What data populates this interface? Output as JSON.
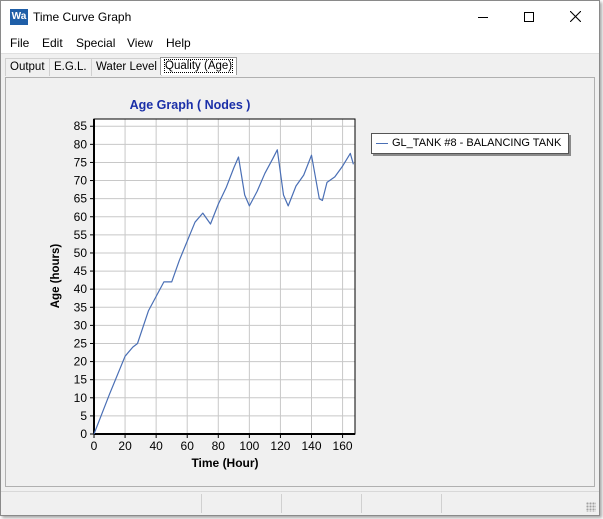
{
  "window": {
    "title": "Time Curve Graph",
    "app_icon_text": "Wa",
    "minimize_icon": "minimize-icon",
    "maximize_icon": "maximize-icon",
    "close_icon": "close-icon"
  },
  "menu": {
    "items": [
      "File",
      "Edit",
      "Special",
      "View",
      "Help"
    ]
  },
  "tabs": [
    {
      "label": "Output",
      "active": false
    },
    {
      "label": "E.G.L.",
      "active": false
    },
    {
      "label": "Water Level",
      "active": false
    },
    {
      "label": "Quality (Age)",
      "active": true
    }
  ],
  "colors": {
    "title": "#1a2fa8",
    "series": "#4a6fb5",
    "grid": "#c8c8c8"
  },
  "chart_data": {
    "type": "line",
    "title": "Age Graph ( Nodes )",
    "xlabel": "Time (Hour)",
    "ylabel": "Age (hours)",
    "xlim": [
      0,
      168
    ],
    "ylim": [
      0,
      87
    ],
    "xticks": [
      0,
      20,
      40,
      60,
      80,
      100,
      120,
      140,
      160
    ],
    "yticks": [
      0,
      5,
      10,
      15,
      20,
      25,
      30,
      35,
      40,
      45,
      50,
      55,
      60,
      65,
      70,
      75,
      80,
      85
    ],
    "grid": true,
    "legend_position": "right",
    "series": [
      {
        "name": "GL_TANK #8 - BALANCING TANK",
        "x": [
          0,
          10,
          20,
          25,
          28,
          35,
          45,
          50,
          55,
          65,
          70,
          75,
          80,
          85,
          90,
          93,
          97,
          100,
          105,
          110,
          115,
          118,
          122,
          125,
          130,
          135,
          140,
          145,
          147,
          150,
          155,
          160,
          165,
          167
        ],
        "y": [
          0,
          11,
          21.5,
          24,
          25,
          34,
          42,
          42,
          48,
          58.5,
          61,
          58,
          63.5,
          68,
          73.5,
          76.5,
          66,
          63,
          67,
          72,
          76,
          78.5,
          66,
          63,
          68.5,
          71.5,
          77,
          65,
          64.5,
          69.5,
          71,
          74,
          77.5,
          74.5
        ]
      }
    ]
  }
}
